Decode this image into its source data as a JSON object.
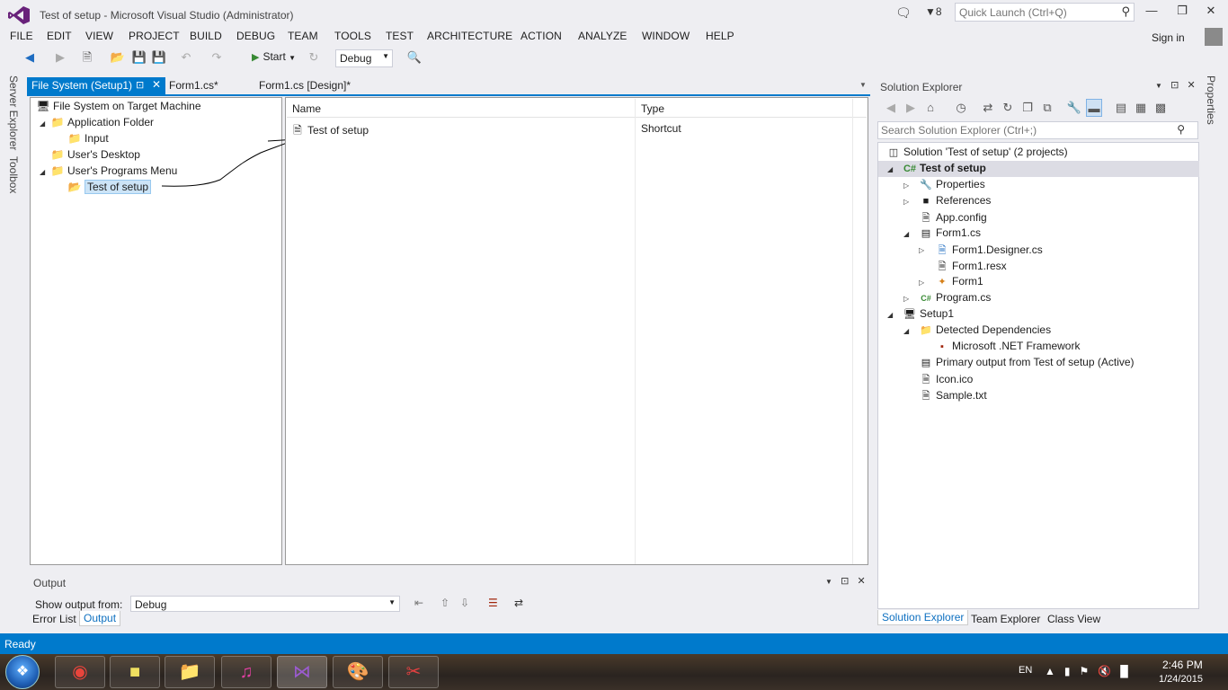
{
  "window": {
    "title": "Test of setup - Microsoft Visual Studio (Administrator)",
    "filter_count": "8",
    "quick_launch_placeholder": "Quick Launch (Ctrl+Q)",
    "sign_in": "Sign in"
  },
  "menu": [
    "FILE",
    "EDIT",
    "VIEW",
    "PROJECT",
    "BUILD",
    "DEBUG",
    "TEAM",
    "TOOLS",
    "TEST",
    "ARCHITECTURE",
    "ACTION",
    "ANALYZE",
    "WINDOW",
    "HELP"
  ],
  "toolbar": {
    "start_label": "Start",
    "config": "Debug"
  },
  "left_strip": [
    "Server Explorer",
    "Toolbox"
  ],
  "tabs": [
    {
      "label": "File System (Setup1)"
    },
    {
      "label": "Form1.cs*"
    },
    {
      "label": "Form1.cs [Design]*"
    }
  ],
  "fs_tree": {
    "root": "File System on Target Machine",
    "app_folder": "Application Folder",
    "input": "Input",
    "desktop": "User's Desktop",
    "programs_menu": "User's Programs Menu",
    "selected": "Test of setup"
  },
  "file_list": {
    "columns": [
      "Name",
      "Type"
    ],
    "rows": [
      {
        "name": "Test of setup",
        "type": "Shortcut"
      }
    ]
  },
  "output": {
    "title": "Output",
    "show_from_label": "Show output from:",
    "source": "Debug",
    "tabs": [
      "Error List",
      "Output"
    ]
  },
  "solution_explorer": {
    "title": "Solution Explorer",
    "search_placeholder": "Search Solution Explorer (Ctrl+;)",
    "items": [
      {
        "label": "Solution 'Test of setup' (2 projects)",
        "icon": "solution-icon"
      },
      {
        "label": "Test of setup",
        "icon": "csharp-project-icon"
      },
      {
        "label": "Properties",
        "icon": "wrench-icon"
      },
      {
        "label": "References",
        "icon": "references-icon"
      },
      {
        "label": "App.config",
        "icon": "config-icon"
      },
      {
        "label": "Form1.cs",
        "icon": "form-icon"
      },
      {
        "label": "Form1.Designer.cs",
        "icon": "cs-file-icon"
      },
      {
        "label": "Form1.resx",
        "icon": "resx-icon"
      },
      {
        "label": "Form1",
        "icon": "class-icon"
      },
      {
        "label": "Program.cs",
        "icon": "csharp-file-icon"
      },
      {
        "label": "Setup1",
        "icon": "setup-project-icon"
      },
      {
        "label": "Detected Dependencies",
        "icon": "folder-icon"
      },
      {
        "label": "Microsoft .NET Framework",
        "icon": "dependency-icon"
      },
      {
        "label": "Primary output from Test of setup (Active)",
        "icon": "output-icon"
      },
      {
        "label": "Icon.ico",
        "icon": "file-icon"
      },
      {
        "label": "Sample.txt",
        "icon": "text-file-icon"
      }
    ],
    "bottom_tabs": [
      "Solution Explorer",
      "Team Explorer",
      "Class View"
    ]
  },
  "properties_strip": "Properties",
  "status": "Ready",
  "tray": {
    "lang": "EN",
    "time": "2:46 PM",
    "date": "1/24/2015"
  },
  "colors": {
    "accent": "#007acc",
    "background": "#eeeef2",
    "selection": "#cce4f7"
  }
}
